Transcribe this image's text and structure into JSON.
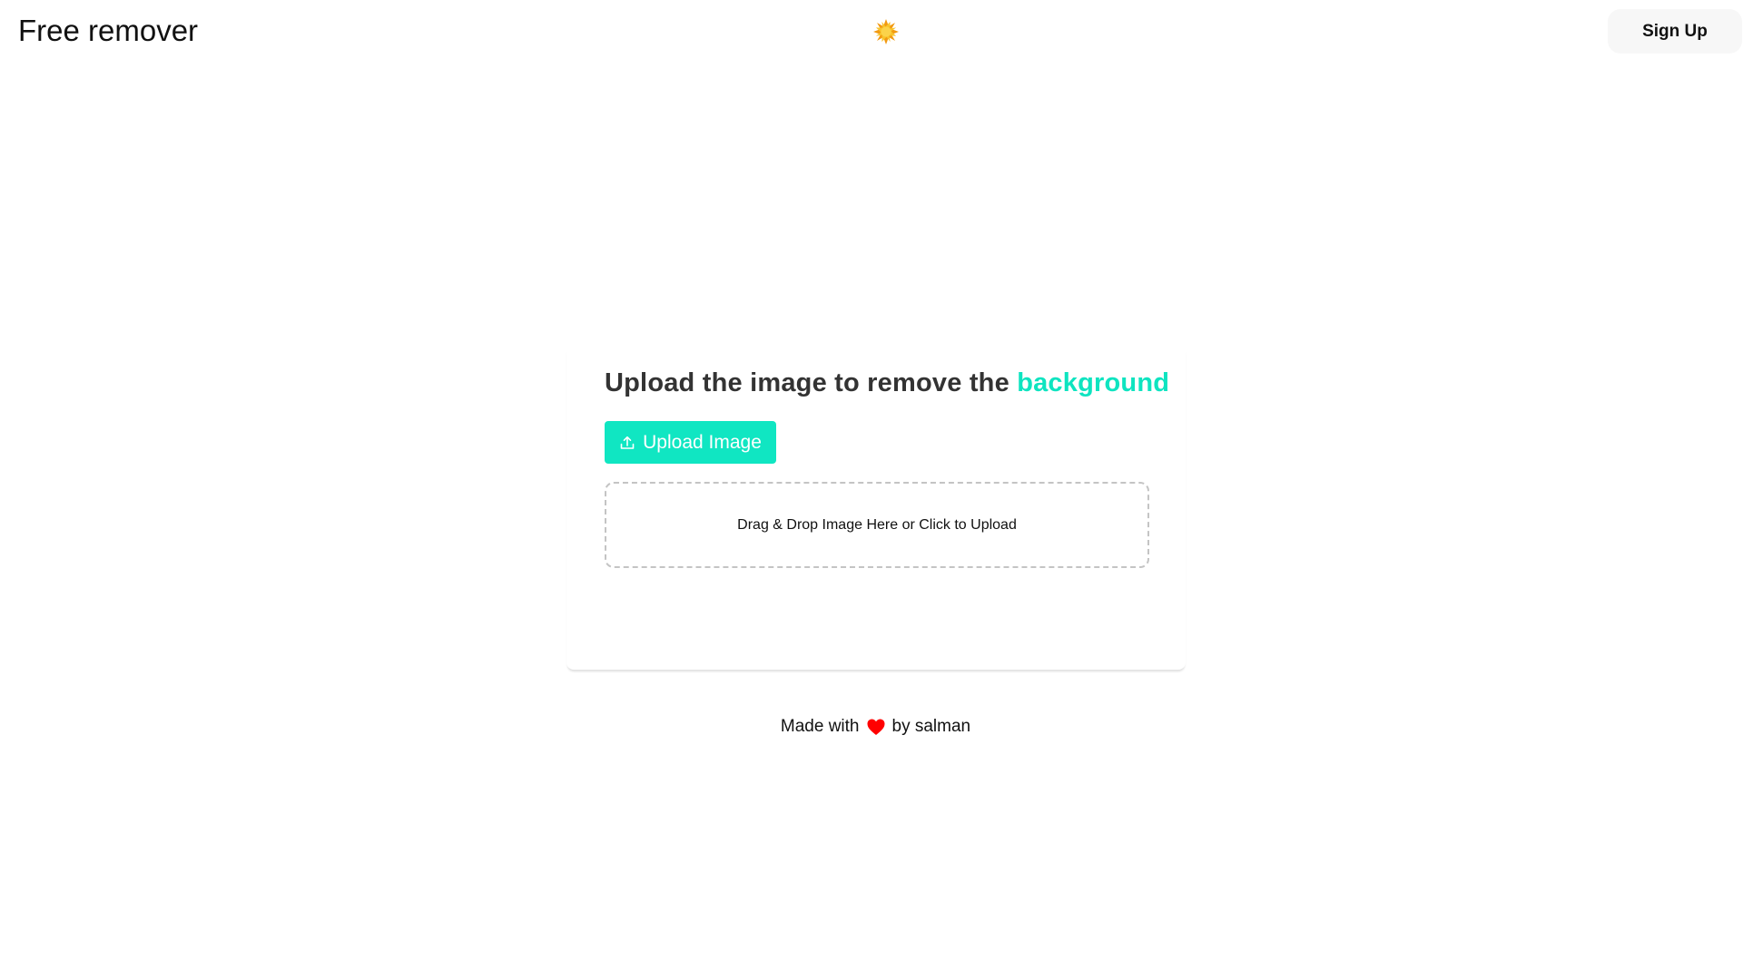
{
  "header": {
    "brand": "Free remover",
    "theme_icon": "sun-icon",
    "signup_label": "Sign Up"
  },
  "main": {
    "headline_prefix": "Upload the image to remove the",
    "headline_accent": "background",
    "upload_button_label": "Upload Image",
    "upload_icon": "upload-icon",
    "dropzone_text": "Drag & Drop Image Here or Click to Upload"
  },
  "footer": {
    "prefix": "Made with",
    "heart_icon": "heart-icon",
    "suffix": "by salman"
  },
  "colors": {
    "accent": "#0ee4c0",
    "button_bg": "#10e6c2",
    "heart": "#ff0000",
    "sun": "#f5b81c"
  }
}
